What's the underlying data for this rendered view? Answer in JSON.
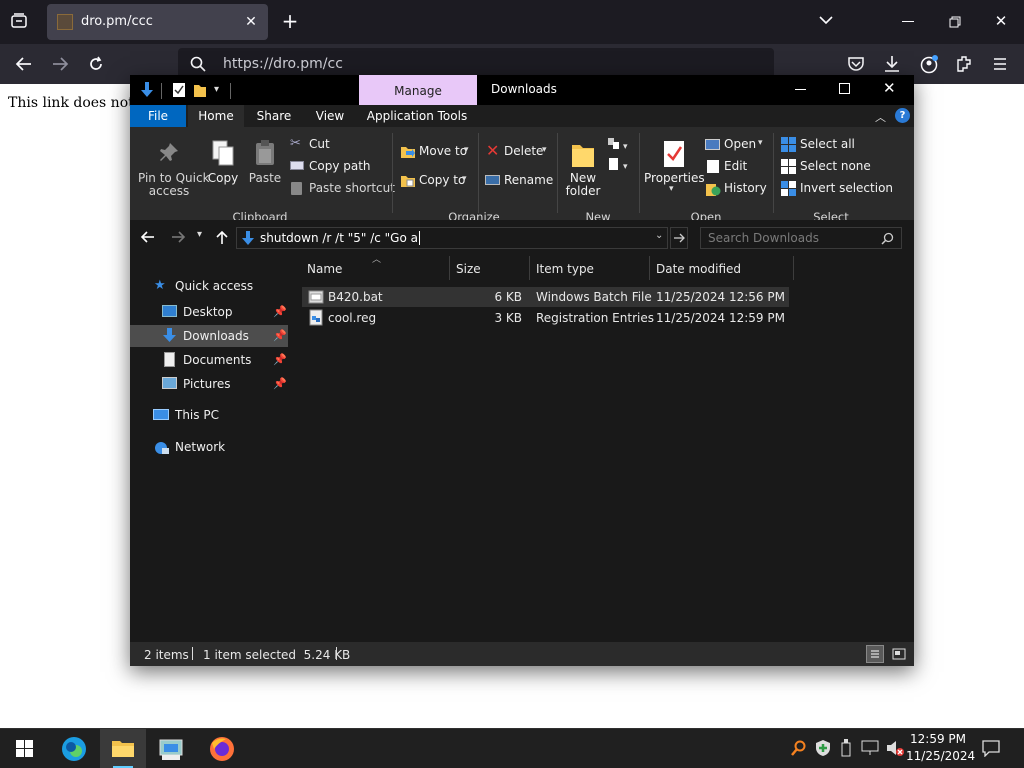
{
  "browser": {
    "tab_title": "dro.pm/ccc",
    "url": "https://dro.pm/cc",
    "page_text": "This link does not e"
  },
  "explorer": {
    "title": "Downloads",
    "manage_label": "Manage",
    "ribbon_tabs": [
      "File",
      "Home",
      "Share",
      "View",
      "Application Tools"
    ],
    "clipboard": {
      "pin_line1": "Pin to Quick",
      "pin_line2": "access",
      "copy": "Copy",
      "paste": "Paste",
      "cut": "Cut",
      "copy_path": "Copy path",
      "paste_shortcut": "Paste shortcut",
      "group": "Clipboard"
    },
    "organize": {
      "move_to": "Move to",
      "copy_to": "Copy to",
      "delete": "Delete",
      "rename": "Rename",
      "group": "Organize"
    },
    "new": {
      "new_folder_line1": "New",
      "new_folder_line2": "folder",
      "group": "New"
    },
    "open": {
      "properties": "Properties",
      "open": "Open",
      "edit": "Edit",
      "history": "History",
      "group": "Open"
    },
    "select": {
      "select_all": "Select all",
      "select_none": "Select none",
      "invert": "Invert selection",
      "group": "Select"
    },
    "address": "shutdown /r /t \"5\" /c \"Go a",
    "search_placeholder": "Search Downloads",
    "nav": {
      "quick_access": "Quick access",
      "desktop": "Desktop",
      "downloads": "Downloads",
      "documents": "Documents",
      "pictures": "Pictures",
      "this_pc": "This PC",
      "network": "Network"
    },
    "columns": [
      "Name",
      "Size",
      "Item type",
      "Date modified"
    ],
    "files": [
      {
        "name": "B420.bat",
        "size": "6 KB",
        "type": "Windows Batch File",
        "date": "11/25/2024 12:56 PM",
        "selected": true,
        "icon": "batch-file-icon"
      },
      {
        "name": "cool.reg",
        "size": "3 KB",
        "type": "Registration Entries",
        "date": "11/25/2024 12:59 PM",
        "selected": false,
        "icon": "registry-file-icon"
      }
    ],
    "status": {
      "items": "2 items",
      "selection": "1 item selected  5.24 KB"
    }
  },
  "taskbar": {
    "time": "12:59 PM",
    "date": "11/25/2024"
  },
  "colors": {
    "accent": "#0067c0",
    "manage_tab": "#e8c8f8",
    "folder": "#f3c24c",
    "selection": "#333333"
  }
}
